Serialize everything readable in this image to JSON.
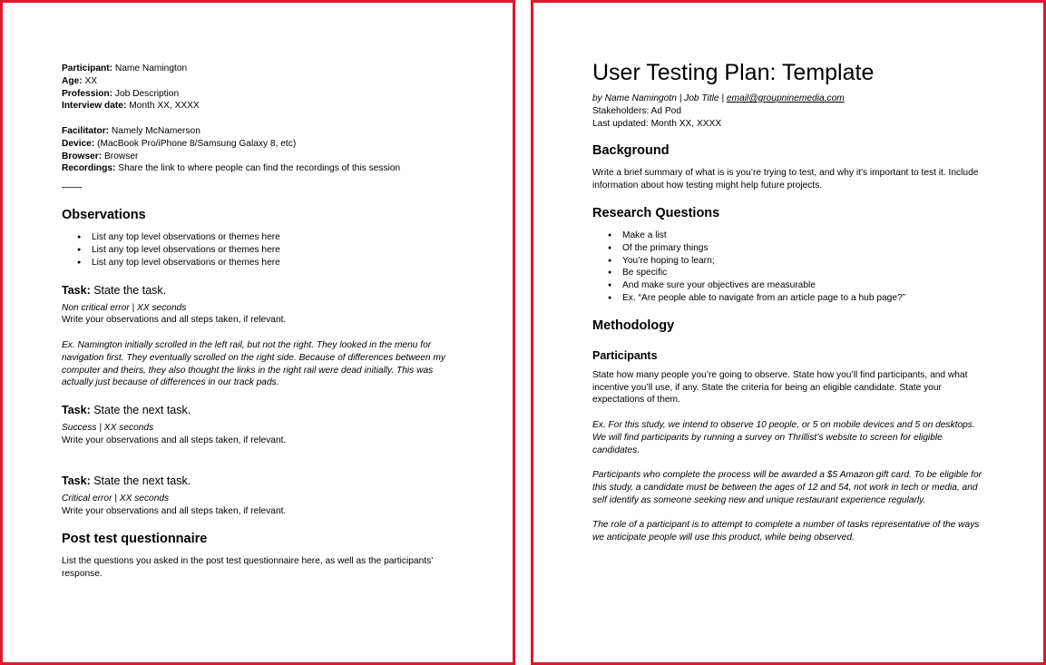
{
  "left": {
    "meta": [
      {
        "label": "Participant:",
        "value": "Name Namington"
      },
      {
        "label": "Age:",
        "value": "XX"
      },
      {
        "label": "Profession:",
        "value": "Job Description"
      },
      {
        "label": "Interview date:",
        "value": "Month XX, XXXX"
      }
    ],
    "meta2": [
      {
        "label": "Facilitator:",
        "value": "Namely McNamerson"
      },
      {
        "label": "Device:",
        "value": "(MacBook Pro/iPhone 8/Samsung Galaxy 8, etc)"
      },
      {
        "label": "Browser:",
        "value": "Browser"
      },
      {
        "label": "Recordings:",
        "value": "Share the link to where people can find the recordings of this session"
      }
    ],
    "observations": {
      "heading": "Observations",
      "items": [
        "List any top level observations or themes here",
        "List any top level observations or themes here",
        "List any top level observations or themes here"
      ]
    },
    "task_label": "Task:",
    "tasks": [
      {
        "title": "State the task.",
        "status": "Non critical error | XX seconds",
        "body": "Write your observations and all steps taken, if relevant.",
        "example": [
          "Ex. Namington initially scrolled in the left rail, but not the right. They looked in the menu for",
          "navigation first. They eventually scrolled on the right side. Because of differences between my",
          "computer and theirs, they also thought the links in the right rail were dead initially. This was",
          "actually just because of differences in our track pads."
        ]
      },
      {
        "title": "State the next task.",
        "status": "Success | XX seconds",
        "body": "Write your observations and all steps taken, if relevant."
      },
      {
        "title": "State the next task.",
        "status": "Critical error | XX seconds",
        "body": "Write your observations and all steps taken, if relevant."
      }
    ],
    "post": {
      "heading": "Post test questionnaire",
      "lines": [
        "List the questions you asked in the post test questionnaire here, as well as the participants’",
        "response."
      ]
    }
  },
  "right": {
    "title": "User Testing Plan: Template",
    "byline_prefix": "by Name Namingotn | Job Title | ",
    "email": "email@groupninemedia.com",
    "stakeholders": "Stakeholders: Ad Pod",
    "updated": "Last updated: Month XX, XXXX",
    "background": {
      "heading": "Background",
      "lines": [
        "Write a brief summary of what is is you’re trying to test, and why it’s important to test it. Include",
        "information about how testing might help future projects."
      ]
    },
    "research": {
      "heading": "Research Questions",
      "items": [
        "Make a list",
        "Of the primary things",
        "You’re hoping to learn;",
        "Be specific",
        "And make sure your objectives are measurable",
        "Ex. “Are people able to navigate from an article page to a hub page?”"
      ]
    },
    "methodology": {
      "heading": "Methodology",
      "sub": "Participants",
      "p1": [
        "State how many people you’re going to observe. State how you’ll find participants, and what",
        "incentive you’ll use, if any. State the criteria for being an eligible candidate. State your",
        "expectations of them."
      ],
      "p2": [
        "Ex. For this study, we intend to observe 10 people, or 5 on mobile devices and 5 on desktops.",
        "We will find participants by running a survey on Thrillist’s website to screen for eligible",
        "candidates."
      ],
      "p3": [
        "Participants who complete the process will be awarded a $5 Amazon gift card. To be eligible for",
        "this study, a candidate must be between the ages of 12 and 54, not work in tech or media, and",
        "self identify as someone seeking new and unique restaurant experience regularly."
      ],
      "p4": [
        "The role of a participant is to attempt to complete a number of tasks representative of the ways",
        "we anticipate people will use this product, while being observed."
      ]
    }
  }
}
